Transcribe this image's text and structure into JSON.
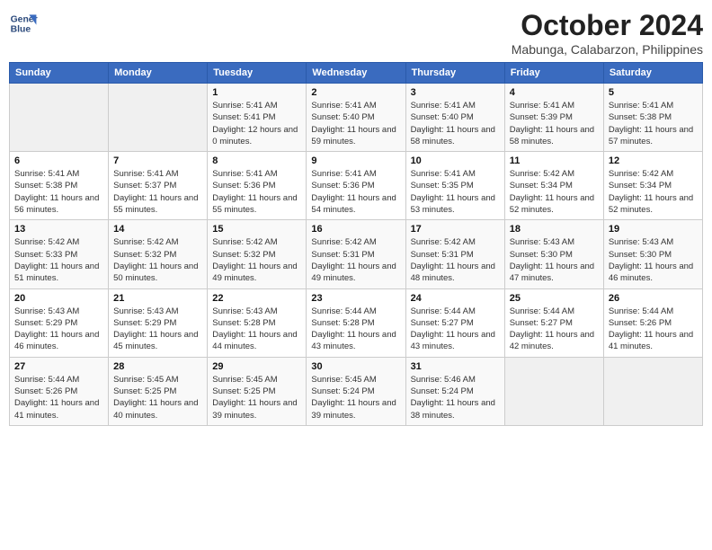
{
  "header": {
    "logo_line1": "General",
    "logo_line2": "Blue",
    "month_title": "October 2024",
    "location": "Mabunga, Calabarzon, Philippines"
  },
  "weekdays": [
    "Sunday",
    "Monday",
    "Tuesday",
    "Wednesday",
    "Thursday",
    "Friday",
    "Saturday"
  ],
  "weeks": [
    [
      {
        "day": "",
        "sunrise": "",
        "sunset": "",
        "daylight": ""
      },
      {
        "day": "",
        "sunrise": "",
        "sunset": "",
        "daylight": ""
      },
      {
        "day": "1",
        "sunrise": "Sunrise: 5:41 AM",
        "sunset": "Sunset: 5:41 PM",
        "daylight": "Daylight: 12 hours and 0 minutes."
      },
      {
        "day": "2",
        "sunrise": "Sunrise: 5:41 AM",
        "sunset": "Sunset: 5:40 PM",
        "daylight": "Daylight: 11 hours and 59 minutes."
      },
      {
        "day": "3",
        "sunrise": "Sunrise: 5:41 AM",
        "sunset": "Sunset: 5:40 PM",
        "daylight": "Daylight: 11 hours and 58 minutes."
      },
      {
        "day": "4",
        "sunrise": "Sunrise: 5:41 AM",
        "sunset": "Sunset: 5:39 PM",
        "daylight": "Daylight: 11 hours and 58 minutes."
      },
      {
        "day": "5",
        "sunrise": "Sunrise: 5:41 AM",
        "sunset": "Sunset: 5:38 PM",
        "daylight": "Daylight: 11 hours and 57 minutes."
      }
    ],
    [
      {
        "day": "6",
        "sunrise": "Sunrise: 5:41 AM",
        "sunset": "Sunset: 5:38 PM",
        "daylight": "Daylight: 11 hours and 56 minutes."
      },
      {
        "day": "7",
        "sunrise": "Sunrise: 5:41 AM",
        "sunset": "Sunset: 5:37 PM",
        "daylight": "Daylight: 11 hours and 55 minutes."
      },
      {
        "day": "8",
        "sunrise": "Sunrise: 5:41 AM",
        "sunset": "Sunset: 5:36 PM",
        "daylight": "Daylight: 11 hours and 55 minutes."
      },
      {
        "day": "9",
        "sunrise": "Sunrise: 5:41 AM",
        "sunset": "Sunset: 5:36 PM",
        "daylight": "Daylight: 11 hours and 54 minutes."
      },
      {
        "day": "10",
        "sunrise": "Sunrise: 5:41 AM",
        "sunset": "Sunset: 5:35 PM",
        "daylight": "Daylight: 11 hours and 53 minutes."
      },
      {
        "day": "11",
        "sunrise": "Sunrise: 5:42 AM",
        "sunset": "Sunset: 5:34 PM",
        "daylight": "Daylight: 11 hours and 52 minutes."
      },
      {
        "day": "12",
        "sunrise": "Sunrise: 5:42 AM",
        "sunset": "Sunset: 5:34 PM",
        "daylight": "Daylight: 11 hours and 52 minutes."
      }
    ],
    [
      {
        "day": "13",
        "sunrise": "Sunrise: 5:42 AM",
        "sunset": "Sunset: 5:33 PM",
        "daylight": "Daylight: 11 hours and 51 minutes."
      },
      {
        "day": "14",
        "sunrise": "Sunrise: 5:42 AM",
        "sunset": "Sunset: 5:32 PM",
        "daylight": "Daylight: 11 hours and 50 minutes."
      },
      {
        "day": "15",
        "sunrise": "Sunrise: 5:42 AM",
        "sunset": "Sunset: 5:32 PM",
        "daylight": "Daylight: 11 hours and 49 minutes."
      },
      {
        "day": "16",
        "sunrise": "Sunrise: 5:42 AM",
        "sunset": "Sunset: 5:31 PM",
        "daylight": "Daylight: 11 hours and 49 minutes."
      },
      {
        "day": "17",
        "sunrise": "Sunrise: 5:42 AM",
        "sunset": "Sunset: 5:31 PM",
        "daylight": "Daylight: 11 hours and 48 minutes."
      },
      {
        "day": "18",
        "sunrise": "Sunrise: 5:43 AM",
        "sunset": "Sunset: 5:30 PM",
        "daylight": "Daylight: 11 hours and 47 minutes."
      },
      {
        "day": "19",
        "sunrise": "Sunrise: 5:43 AM",
        "sunset": "Sunset: 5:30 PM",
        "daylight": "Daylight: 11 hours and 46 minutes."
      }
    ],
    [
      {
        "day": "20",
        "sunrise": "Sunrise: 5:43 AM",
        "sunset": "Sunset: 5:29 PM",
        "daylight": "Daylight: 11 hours and 46 minutes."
      },
      {
        "day": "21",
        "sunrise": "Sunrise: 5:43 AM",
        "sunset": "Sunset: 5:29 PM",
        "daylight": "Daylight: 11 hours and 45 minutes."
      },
      {
        "day": "22",
        "sunrise": "Sunrise: 5:43 AM",
        "sunset": "Sunset: 5:28 PM",
        "daylight": "Daylight: 11 hours and 44 minutes."
      },
      {
        "day": "23",
        "sunrise": "Sunrise: 5:44 AM",
        "sunset": "Sunset: 5:28 PM",
        "daylight": "Daylight: 11 hours and 43 minutes."
      },
      {
        "day": "24",
        "sunrise": "Sunrise: 5:44 AM",
        "sunset": "Sunset: 5:27 PM",
        "daylight": "Daylight: 11 hours and 43 minutes."
      },
      {
        "day": "25",
        "sunrise": "Sunrise: 5:44 AM",
        "sunset": "Sunset: 5:27 PM",
        "daylight": "Daylight: 11 hours and 42 minutes."
      },
      {
        "day": "26",
        "sunrise": "Sunrise: 5:44 AM",
        "sunset": "Sunset: 5:26 PM",
        "daylight": "Daylight: 11 hours and 41 minutes."
      }
    ],
    [
      {
        "day": "27",
        "sunrise": "Sunrise: 5:44 AM",
        "sunset": "Sunset: 5:26 PM",
        "daylight": "Daylight: 11 hours and 41 minutes."
      },
      {
        "day": "28",
        "sunrise": "Sunrise: 5:45 AM",
        "sunset": "Sunset: 5:25 PM",
        "daylight": "Daylight: 11 hours and 40 minutes."
      },
      {
        "day": "29",
        "sunrise": "Sunrise: 5:45 AM",
        "sunset": "Sunset: 5:25 PM",
        "daylight": "Daylight: 11 hours and 39 minutes."
      },
      {
        "day": "30",
        "sunrise": "Sunrise: 5:45 AM",
        "sunset": "Sunset: 5:24 PM",
        "daylight": "Daylight: 11 hours and 39 minutes."
      },
      {
        "day": "31",
        "sunrise": "Sunrise: 5:46 AM",
        "sunset": "Sunset: 5:24 PM",
        "daylight": "Daylight: 11 hours and 38 minutes."
      },
      {
        "day": "",
        "sunrise": "",
        "sunset": "",
        "daylight": ""
      },
      {
        "day": "",
        "sunrise": "",
        "sunset": "",
        "daylight": ""
      }
    ]
  ]
}
